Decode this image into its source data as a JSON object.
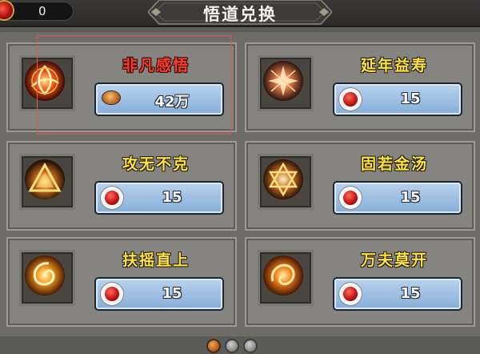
{
  "currency": {
    "icon": "red-gem-icon",
    "value": "0"
  },
  "title": "悟道兑换",
  "items": [
    {
      "name": "非凡感悟",
      "name_color": "red",
      "cost_icon": "copper-coin-icon",
      "cost": "42万",
      "selected": true,
      "icon": "red-trinity-knot-icon"
    },
    {
      "name": "延年益寿",
      "name_color": "yellow",
      "cost_icon": "red-gem-icon",
      "cost": "15",
      "selected": false,
      "icon": "amber-star-burst-icon"
    },
    {
      "name": "攻无不克",
      "name_color": "yellow",
      "cost_icon": "red-gem-icon",
      "cost": "15",
      "selected": false,
      "icon": "golden-triangle-icon"
    },
    {
      "name": "固若金汤",
      "name_color": "yellow",
      "cost_icon": "red-gem-icon",
      "cost": "15",
      "selected": false,
      "icon": "golden-hexagram-icon"
    },
    {
      "name": "扶摇直上",
      "name_color": "yellow",
      "cost_icon": "red-gem-icon",
      "cost": "15",
      "selected": false,
      "icon": "fire-swirl-icon"
    },
    {
      "name": "万夫莫开",
      "name_color": "yellow",
      "cost_icon": "red-gem-icon",
      "cost": "15",
      "selected": false,
      "icon": "flame-vortex-icon"
    }
  ],
  "pagination": {
    "pages": 3,
    "current": 1
  },
  "colors": {
    "name_red": "#ff3b2a",
    "name_yellow": "#ffe23a",
    "price_blue": "#9cc0e4",
    "highlight": "#e05656"
  }
}
